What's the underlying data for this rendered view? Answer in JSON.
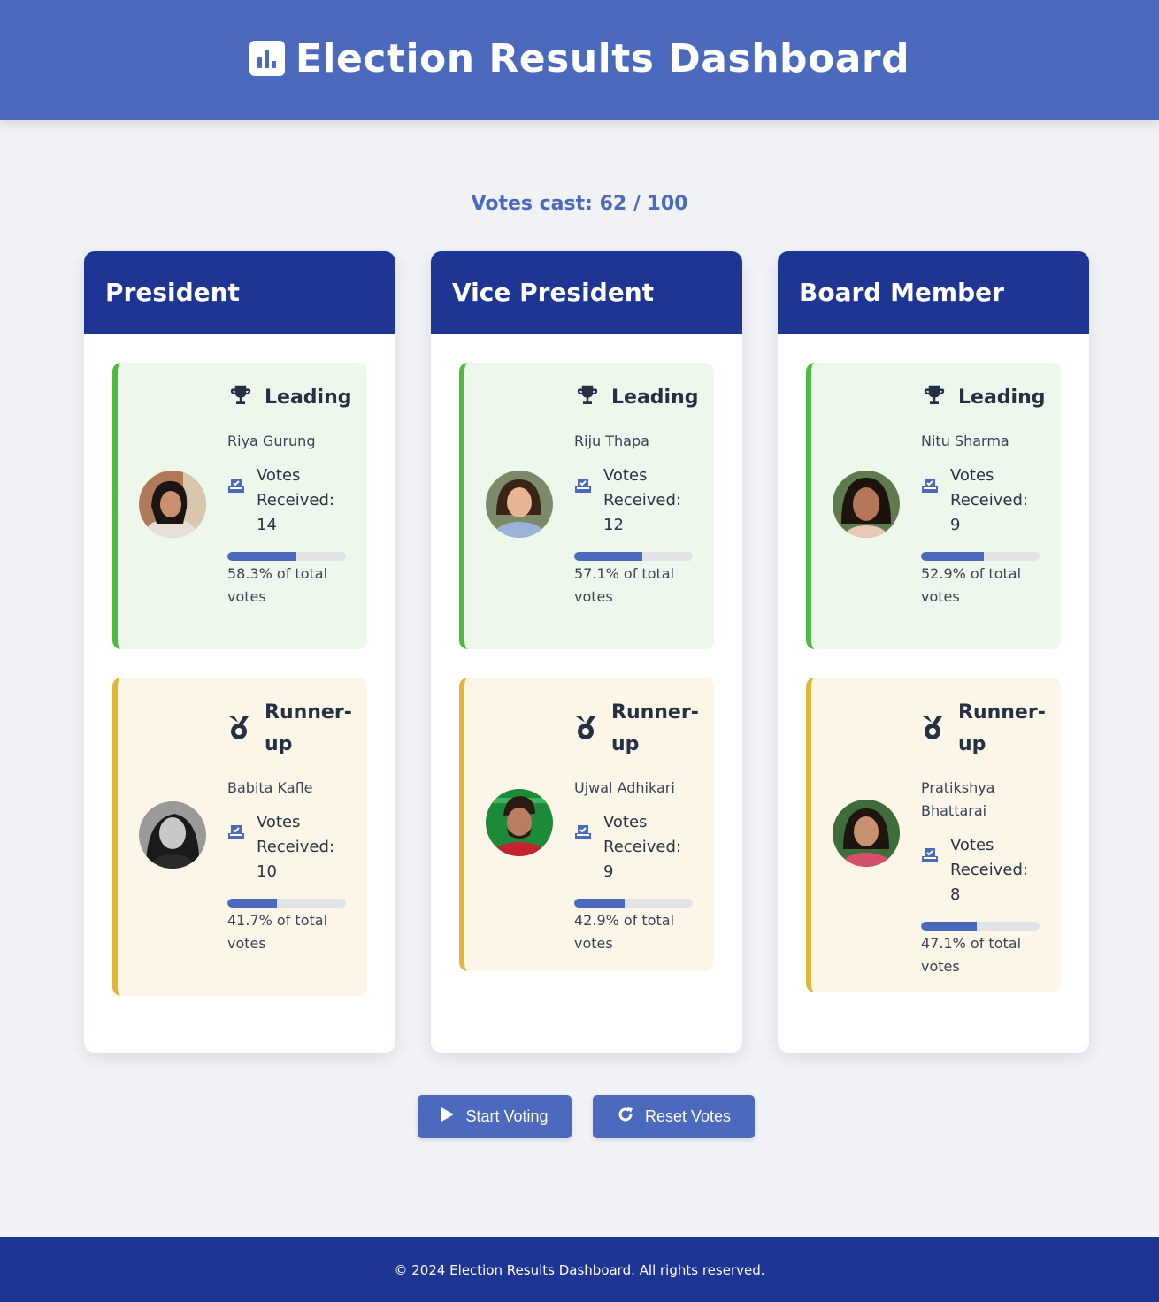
{
  "header": {
    "title": "Election Results Dashboard",
    "icon": "bar-chart-icon"
  },
  "summary": {
    "votes_cast": "Votes cast: 62 / 100"
  },
  "positions": [
    {
      "title": "President",
      "leading": {
        "status": "Leading",
        "name": "Riya Gurung",
        "votes": "Votes Received: 14",
        "pct_text": "58.3% of total votes",
        "pct": 58.3
      },
      "runner": {
        "status": "Runner-up",
        "name": "Babita Kafle",
        "votes": "Votes Received: 10",
        "pct_text": "41.7% of total votes",
        "pct": 41.7
      }
    },
    {
      "title": "Vice President",
      "leading": {
        "status": "Leading",
        "name": "Riju Thapa",
        "votes": "Votes Received: 12",
        "pct_text": "57.1% of total votes",
        "pct": 57.1
      },
      "runner": {
        "status": "Runner-up",
        "name": "Ujwal Adhikari",
        "votes": "Votes Received: 9",
        "pct_text": "42.9% of total votes",
        "pct": 42.9
      }
    },
    {
      "title": "Board Member",
      "leading": {
        "status": "Leading",
        "name": "Nitu Sharma",
        "votes": "Votes Received: 9",
        "pct_text": "52.9% of total votes",
        "pct": 52.9
      },
      "runner": {
        "status": "Runner-up",
        "name": "Pratikshya Bhattarai",
        "votes": "Votes Received: 8",
        "pct_text": "47.1% of total votes",
        "pct": 47.1
      }
    }
  ],
  "buttons": {
    "start": "Start Voting",
    "reset": "Reset Votes"
  },
  "footer": {
    "text": "© 2024 Election Results Dashboard. All rights reserved."
  },
  "colors": {
    "primary": "#4b69bd",
    "navy": "#1f3594",
    "leading_accent": "#4cbb3f",
    "runner_accent": "#e2b63a"
  }
}
